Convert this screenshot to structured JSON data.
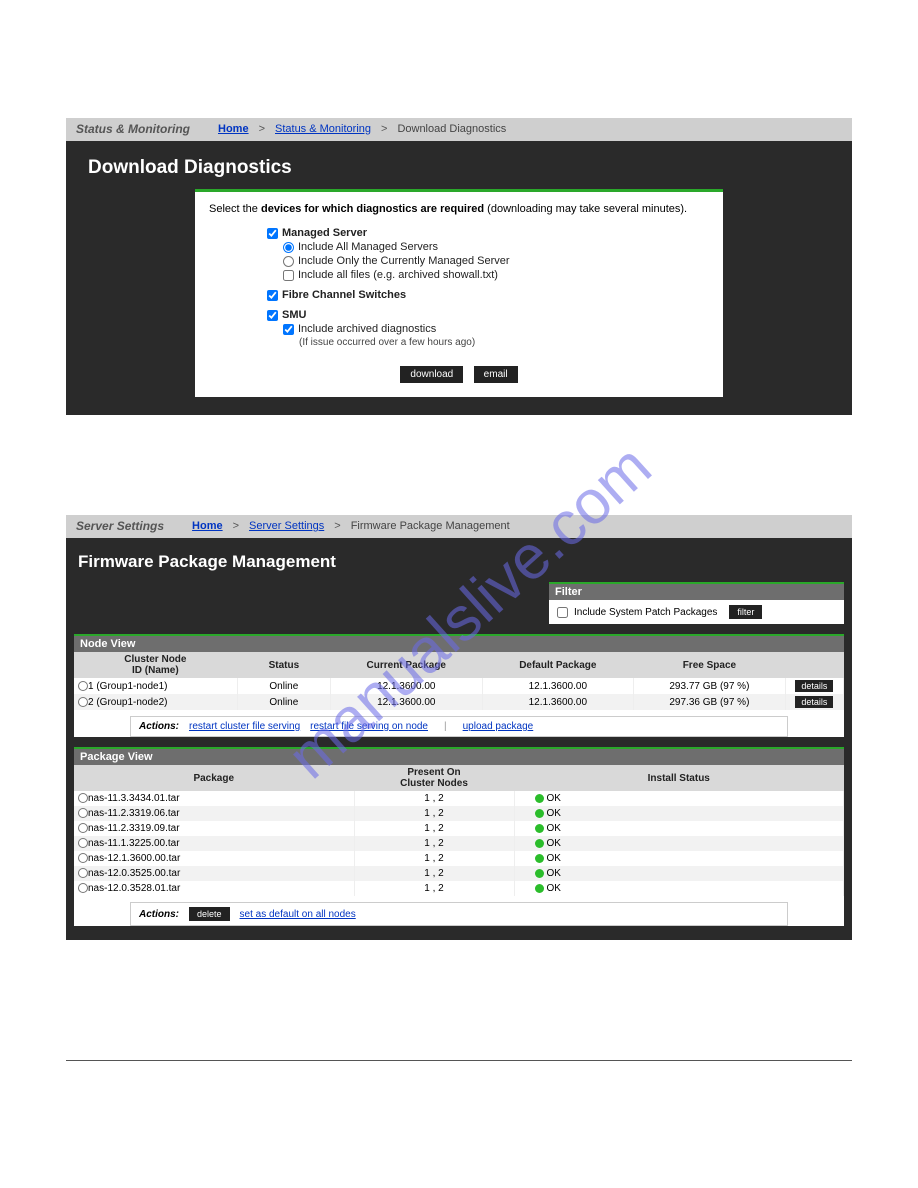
{
  "watermark_text": "manualslive.com",
  "panel1": {
    "breadcrumb": {
      "section": "Status & Monitoring",
      "home": "Home",
      "sep": ">",
      "mid": "Status & Monitoring",
      "current": "Download Diagnostics"
    },
    "title": "Download Diagnostics",
    "instruction_prefix": "Select the ",
    "instruction_bold": "devices for which diagnostics are required",
    "instruction_suffix": " (downloading may take several minutes).",
    "managed_server": {
      "label": "Managed Server",
      "opt_all": "Include All Managed Servers",
      "opt_only": "Include Only the Currently Managed Server",
      "opt_files": "Include all files (e.g. archived showall.txt)"
    },
    "fc_label": "Fibre Channel Switches",
    "smu": {
      "label": "SMU",
      "archived": "Include archived diagnostics",
      "hint": "(If issue occurred over a few hours ago)"
    },
    "btn_download": "download",
    "btn_email": "email"
  },
  "panel2": {
    "breadcrumb": {
      "section": "Server Settings",
      "home": "Home",
      "sep": ">",
      "mid": "Server Settings",
      "current": "Firmware Package Management"
    },
    "title": "Firmware Package Management",
    "filter": {
      "header": "Filter",
      "chk_label": "Include System Patch Packages",
      "btn": "filter"
    },
    "node_view": {
      "header": "Node View",
      "cols": {
        "id_line1": "Cluster Node",
        "id_line2": "ID (Name)",
        "status": "Status",
        "current": "Current Package",
        "default": "Default Package",
        "free": "Free Space",
        "blank": ""
      },
      "rows": [
        {
          "id": "1 (Group1-node1)",
          "status": "Online",
          "current": "12.1.3600.00",
          "default": "12.1.3600.00",
          "free": "293.77 GB (97 %)",
          "btn": "details"
        },
        {
          "id": "2 (Group1-node2)",
          "status": "Online",
          "current": "12.1.3600.00",
          "default": "12.1.3600.00",
          "free": "297.36 GB (97 %)",
          "btn": "details"
        }
      ],
      "actions": {
        "label": "Actions:",
        "restart_cluster": "restart cluster file serving",
        "restart_node": "restart file serving on node",
        "upload": "upload package"
      }
    },
    "pkg_view": {
      "header": "Package View",
      "cols": {
        "pkg": "Package",
        "present_line1": "Present On",
        "present_line2": "Cluster Nodes",
        "install": "Install Status"
      },
      "rows": [
        {
          "pkg": "nas-11.3.3434.01.tar",
          "nodes": "1 , 2",
          "status": "OK"
        },
        {
          "pkg": "nas-11.2.3319.06.tar",
          "nodes": "1 , 2",
          "status": "OK"
        },
        {
          "pkg": "nas-11.2.3319.09.tar",
          "nodes": "1 , 2",
          "status": "OK"
        },
        {
          "pkg": "nas-11.1.3225.00.tar",
          "nodes": "1 , 2",
          "status": "OK"
        },
        {
          "pkg": "nas-12.1.3600.00.tar",
          "nodes": "1 , 2",
          "status": "OK"
        },
        {
          "pkg": "nas-12.0.3525.00.tar",
          "nodes": "1 , 2",
          "status": "OK"
        },
        {
          "pkg": "nas-12.0.3528.01.tar",
          "nodes": "1 , 2",
          "status": "OK"
        }
      ],
      "actions": {
        "label": "Actions:",
        "delete": "delete",
        "set_default": "set as default on all nodes"
      }
    }
  }
}
